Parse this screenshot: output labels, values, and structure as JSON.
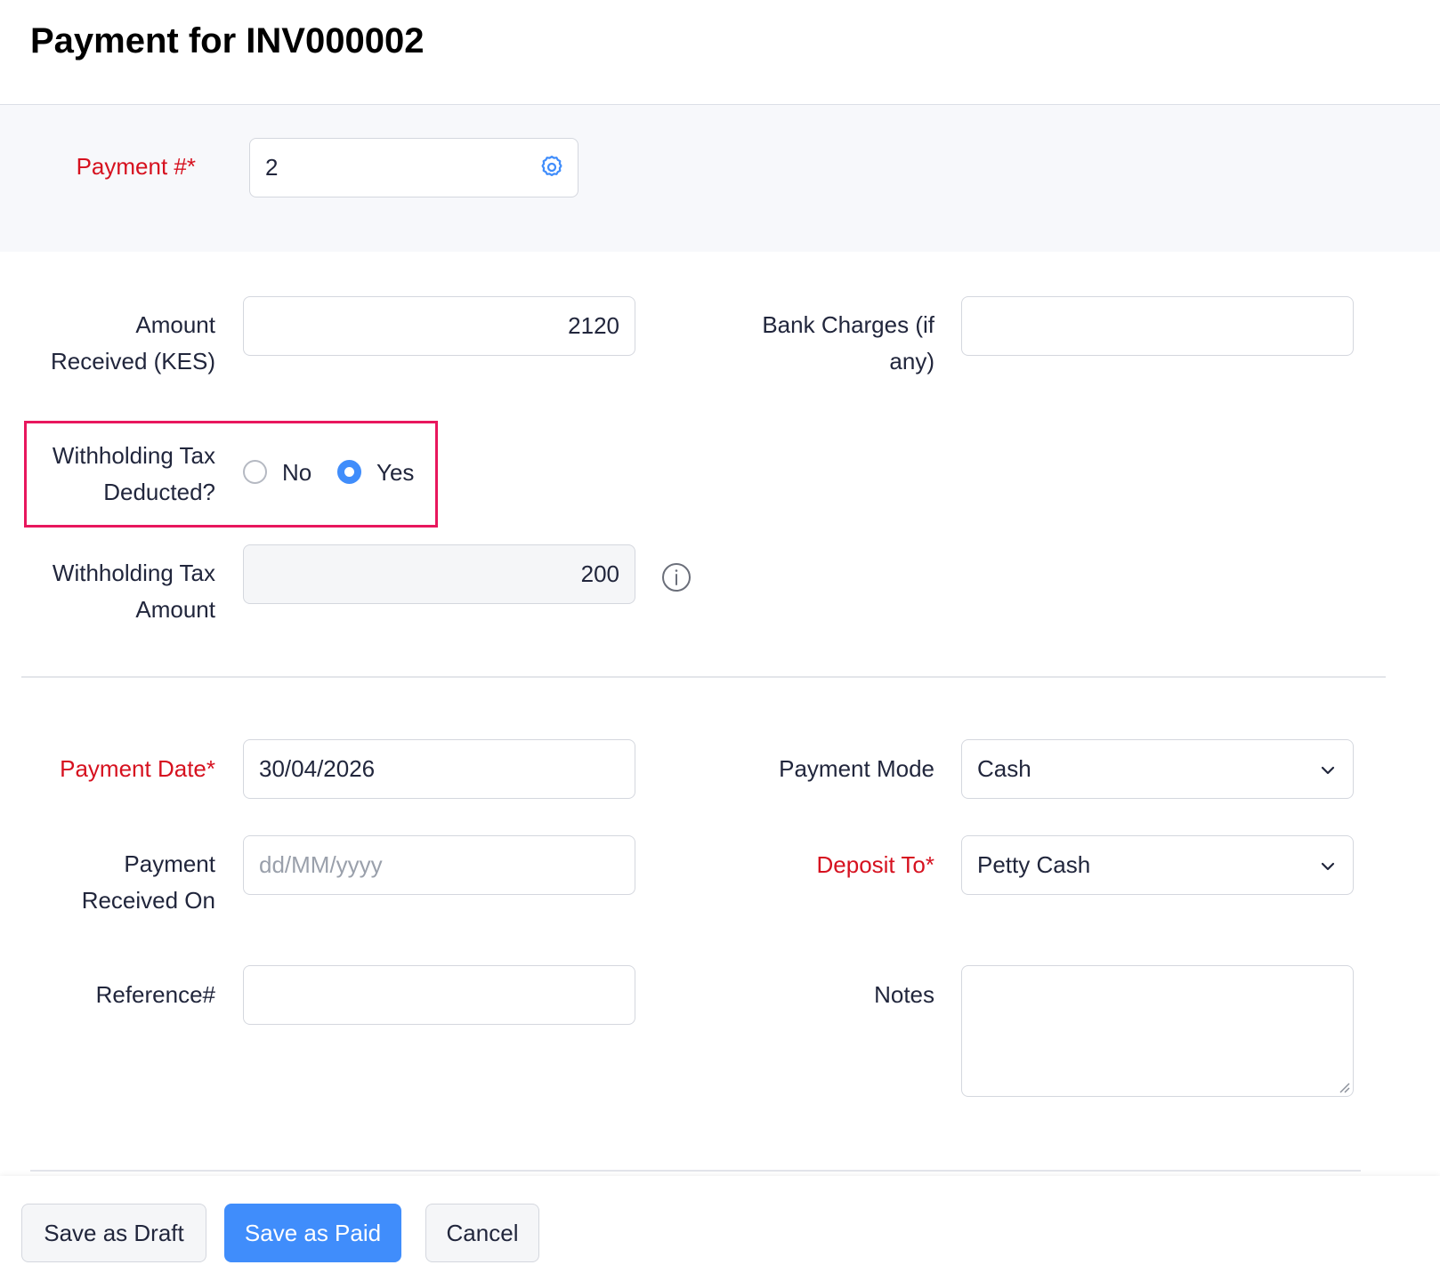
{
  "page": {
    "title": "Payment for INV000002"
  },
  "payment_number": {
    "label": "Payment #*",
    "value": "2",
    "icon": "gear-icon"
  },
  "amount_received": {
    "label_line1": "Amount",
    "label_line2": "Received (KES)",
    "value": "2120"
  },
  "bank_charges": {
    "label_line1": "Bank Charges (if",
    "label_line2": "any)",
    "value": ""
  },
  "withholding_tax_deducted": {
    "label_line1": "Withholding Tax",
    "label_line2": "Deducted?",
    "options": [
      {
        "label": "No",
        "checked": false
      },
      {
        "label": "Yes",
        "checked": true
      }
    ]
  },
  "withholding_tax_amount": {
    "label_line1": "Withholding Tax",
    "label_line2": "Amount",
    "value": "200",
    "icon": "info-icon"
  },
  "payment_date": {
    "label": "Payment Date*",
    "value": "30/04/2026"
  },
  "payment_mode": {
    "label": "Payment Mode",
    "value": "Cash"
  },
  "payment_received_on": {
    "label_line1": "Payment",
    "label_line2": "Received On",
    "placeholder": "dd/MM/yyyy"
  },
  "deposit_to": {
    "label": "Deposit To*",
    "value": "Petty Cash"
  },
  "reference": {
    "label": "Reference#",
    "value": ""
  },
  "notes": {
    "label": "Notes",
    "value": ""
  },
  "footer": {
    "save_draft": "Save as Draft",
    "save_paid": "Save as Paid",
    "cancel": "Cancel"
  },
  "colors": {
    "accent": "#408dfb",
    "required": "#d6111f",
    "highlight": "#e8175d"
  }
}
